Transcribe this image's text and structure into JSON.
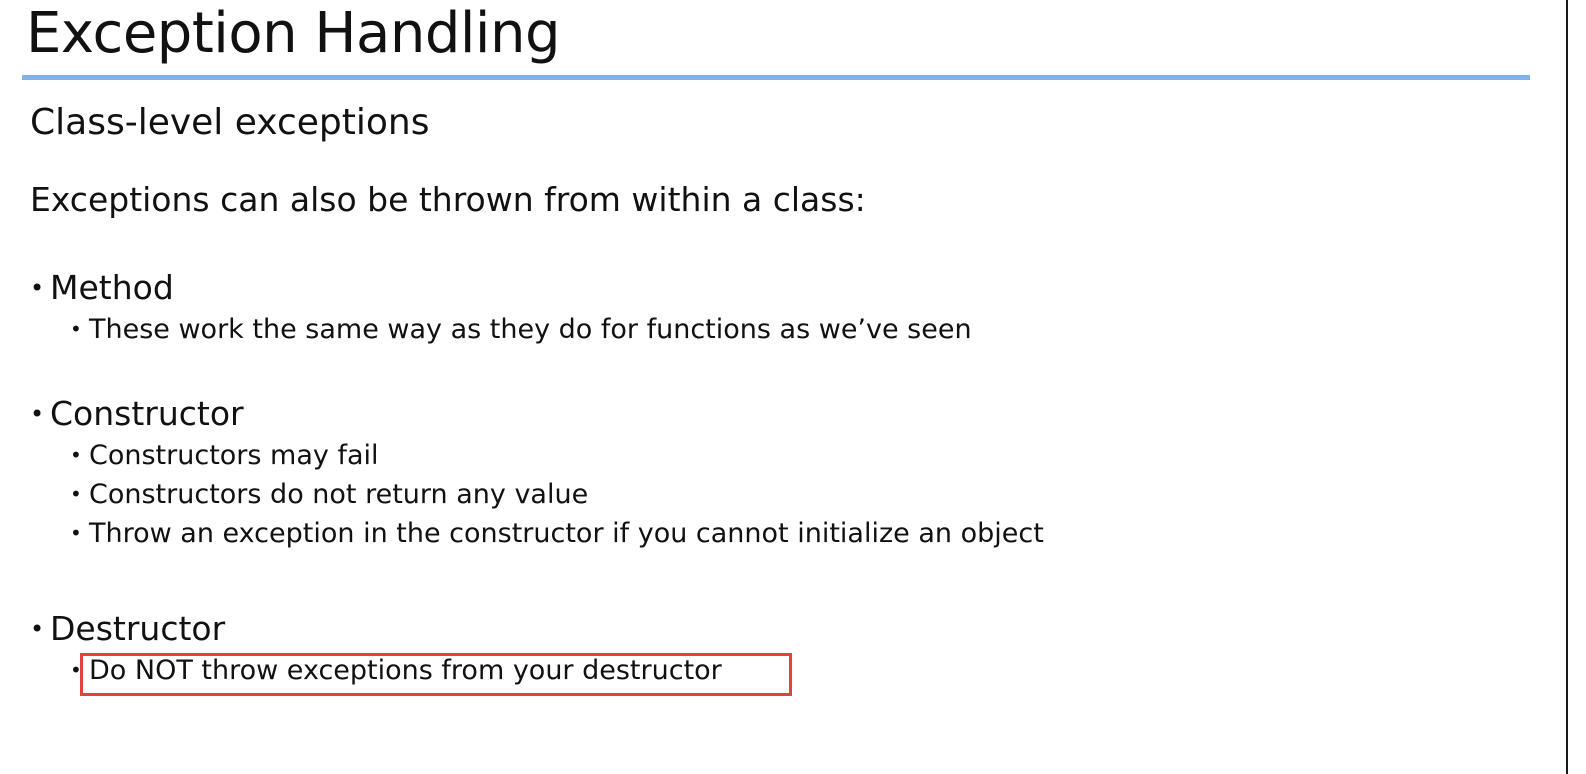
{
  "title": "Exception Handling",
  "subtitle": "Class-level exceptions",
  "intro": "Exceptions can also be thrown from within a class:",
  "bullet_symbol": "•",
  "sections": [
    {
      "heading": "Method",
      "items": [
        "These work the same way as they do for functions as we’ve seen"
      ]
    },
    {
      "heading": "Constructor",
      "items": [
        "Constructors may fail",
        "Constructors do not return any value",
        "Throw an exception in the constructor if you cannot initialize an object"
      ]
    },
    {
      "heading": "Destructor",
      "items": [
        "Do NOT throw exceptions from your destructor"
      ]
    }
  ],
  "colors": {
    "title_rule": "#7fb2ea",
    "highlight_box": "#e0443a",
    "text": "#111111"
  }
}
